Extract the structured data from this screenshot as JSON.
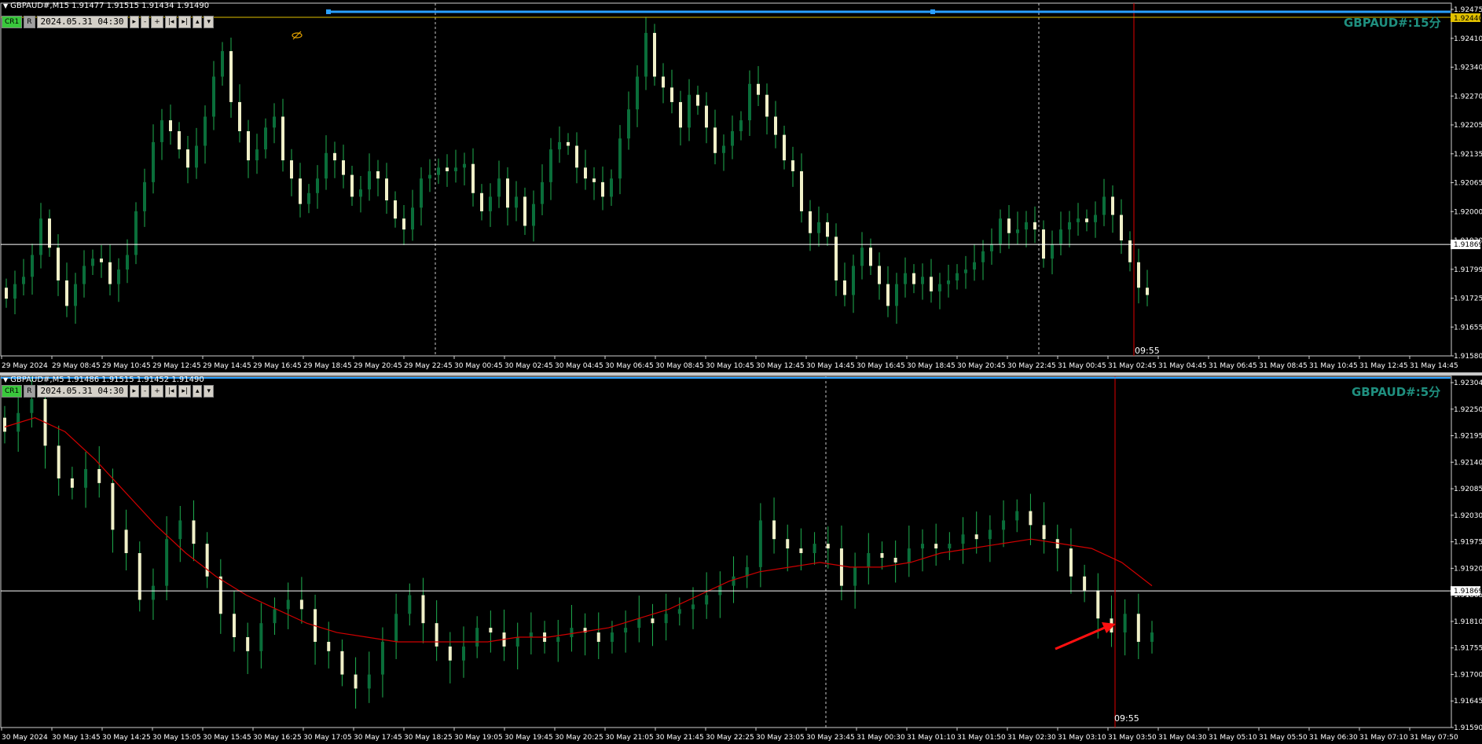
{
  "colors": {
    "bull": "#0a6e3a",
    "bear": "#f0f0c8",
    "wick": "#1fb050",
    "grid": "#808080",
    "hline": "#ffffff",
    "vred": "#e00000",
    "yellow": "#e0c000",
    "ma": "#d00000",
    "label": "#1f8f7f"
  },
  "top": {
    "info": "GBPAUD#,M15  1.91477 1.91515 1.91434 1.91490",
    "watermark": "GBPAUD#:15分",
    "toolbar": {
      "cr": "CR1",
      "r": "R",
      "date": "2024.05.31 04:30",
      "btns": [
        "▸",
        "-",
        "+",
        "|◂",
        "▸|",
        "▴",
        "▾"
      ]
    },
    "cursor_time": "09:55",
    "current_price": "1.91869",
    "price_box_yellow": "1.92440",
    "price_labels": [
      "1.92475",
      "1.92410",
      "1.92340",
      "1.92270",
      "1.92205",
      "1.92135",
      "1.92065",
      "1.92000",
      "1.91930",
      "1.91799",
      "1.91725",
      "1.91655",
      "1.91580"
    ],
    "time_labels": [
      "29 May 2024",
      "29 May 08:45",
      "29 May 10:45",
      "29 May 12:45",
      "29 May 14:45",
      "29 May 16:45",
      "29 May 18:45",
      "29 May 20:45",
      "29 May 22:45",
      "30 May 00:45",
      "30 May 02:45",
      "30 May 04:45",
      "30 May 06:45",
      "30 May 08:45",
      "30 May 10:45",
      "30 May 12:45",
      "30 May 14:45",
      "30 May 16:45",
      "30 May 18:45",
      "30 May 20:45",
      "30 May 22:45",
      "31 May 00:45",
      "31 May 02:45",
      "31 May 04:45",
      "31 May 06:45",
      "31 May 08:45",
      "31 May 10:45",
      "31 May 12:45",
      "31 May 14:45"
    ]
  },
  "bottom": {
    "info": "GBPAUD#,M5  1.91486 1.91515 1.91452 1.91490",
    "watermark": "GBPAUD#:5分",
    "toolbar": {
      "cr": "CR1",
      "r": "R",
      "date": "2024.05.31 04:30",
      "btns": [
        "▸",
        "-",
        "+",
        "|◂",
        "▸|",
        "▴",
        "▾"
      ]
    },
    "cursor_time": "09:55",
    "current_price": "1.91869",
    "price_labels": [
      "1.92304",
      "1.92250",
      "1.92195",
      "1.92140",
      "1.92085",
      "1.92030",
      "1.91975",
      "1.91920",
      "1.91865",
      "1.91810",
      "1.91755",
      "1.91700",
      "1.91645",
      "1.91590"
    ],
    "time_labels": [
      "30 May 2024",
      "30 May 13:45",
      "30 May 14:25",
      "30 May 15:05",
      "30 May 15:45",
      "30 May 16:25",
      "30 May 17:05",
      "30 May 17:45",
      "30 May 18:25",
      "30 May 19:05",
      "30 May 19:45",
      "30 May 20:25",
      "30 May 21:05",
      "30 May 21:45",
      "30 May 22:25",
      "30 May 23:05",
      "30 May 23:45",
      "31 May 00:30",
      "31 May 01:10",
      "31 May 01:50",
      "31 May 02:30",
      "31 May 03:10",
      "31 May 03:50",
      "31 May 04:30",
      "31 May 05:10",
      "31 May 05:50",
      "31 May 06:30",
      "31 May 07:10",
      "31 May 07:50"
    ]
  },
  "chart_data": [
    {
      "type": "candlestick",
      "title": "GBPAUD#,M15",
      "ylim": [
        1.9158,
        1.9248
      ],
      "series": [
        {
          "name": "GBPAUD#",
          "close": [
            1.9172,
            1.9176,
            1.9178,
            1.9184,
            1.9194,
            1.9186,
            1.9177,
            1.917,
            1.9176,
            1.9181,
            1.9183,
            1.9182,
            1.9176,
            1.918,
            1.9184,
            1.9196,
            1.9204,
            1.9215,
            1.9221,
            1.9218,
            1.9213,
            1.9208,
            1.9214,
            1.9222,
            1.9233,
            1.924,
            1.9226,
            1.9218,
            1.921,
            1.9213,
            1.9219,
            1.9222,
            1.921,
            1.9205,
            1.9198,
            1.9201,
            1.9205,
            1.9212,
            1.921,
            1.9206,
            1.92,
            1.9202,
            1.9207,
            1.9205,
            1.9199,
            1.9194,
            1.9191,
            1.9197,
            1.9205,
            1.9206,
            1.9208,
            1.9207,
            1.9208,
            1.9209,
            1.9201,
            1.9196,
            1.92,
            1.9205,
            1.9197,
            1.92,
            1.9192,
            1.9198,
            1.9204,
            1.9213,
            1.9215,
            1.9214,
            1.9208,
            1.9205,
            1.9204,
            1.92,
            1.9205,
            1.9216,
            1.9224,
            1.9233,
            1.9245,
            1.9233,
            1.923,
            1.9226,
            1.9219,
            1.9228,
            1.9225,
            1.9219,
            1.9212,
            1.9214,
            1.9218,
            1.9221,
            1.9231,
            1.9228,
            1.9222,
            1.9217,
            1.921,
            1.9207,
            1.9196,
            1.919,
            1.9193,
            1.9189,
            1.9177,
            1.9173,
            1.9181,
            1.9186,
            1.9181,
            1.9176,
            1.917,
            1.9176,
            1.9179,
            1.9176,
            1.9178,
            1.9174,
            1.9176,
            1.9177,
            1.9179,
            1.918,
            1.9182,
            1.9185,
            1.9187,
            1.9194,
            1.919,
            1.9191,
            1.9193,
            1.9191,
            1.9183,
            1.9187,
            1.9191,
            1.9193,
            1.9194,
            1.9193,
            1.9195,
            1.92,
            1.9195,
            1.9188,
            1.9182,
            1.9175,
            1.9173
          ]
        }
      ]
    },
    {
      "type": "candlestick",
      "title": "GBPAUD#,M5",
      "ylim": [
        1.9159,
        1.923
      ],
      "series": [
        {
          "name": "GBPAUD#",
          "close": [
            1.9221,
            1.9225,
            1.9228,
            1.9218,
            1.9211,
            1.9209,
            1.9213,
            1.921,
            1.92,
            1.9195,
            1.9185,
            1.9188,
            1.9198,
            1.9202,
            1.9197,
            1.919,
            1.9182,
            1.9177,
            1.9174,
            1.918,
            1.9183,
            1.9185,
            1.9183,
            1.9176,
            1.9174,
            1.9169,
            1.9166,
            1.9169,
            1.9176,
            1.9182,
            1.9186,
            1.918,
            1.9175,
            1.9172,
            1.9175,
            1.9179,
            1.9178,
            1.9175,
            1.9177,
            1.9178,
            1.9176,
            1.9177,
            1.9179,
            1.9178,
            1.9176,
            1.9178,
            1.9179,
            1.9181,
            1.918,
            1.9182,
            1.9183,
            1.9184,
            1.9186,
            1.9188,
            1.919,
            1.9192,
            1.9202,
            1.9198,
            1.9196,
            1.9195,
            1.9197,
            1.9196,
            1.9188,
            1.9192,
            1.9195,
            1.9194,
            1.9193,
            1.9196,
            1.9197,
            1.9196,
            1.9197,
            1.9199,
            1.9198,
            1.92,
            1.9202,
            1.9204,
            1.9201,
            1.9198,
            1.9196,
            1.919,
            1.9187,
            1.9181,
            1.9178,
            1.9182,
            1.9176,
            1.9178
          ]
        },
        {
          "name": "MA",
          "values": [
            1.9222,
            1.9224,
            1.9221,
            1.9215,
            1.9208,
            1.9201,
            1.9195,
            1.919,
            1.9186,
            1.9183,
            1.918,
            1.9178,
            1.9177,
            1.9176,
            1.9176,
            1.9176,
            1.9176,
            1.9177,
            1.9177,
            1.9178,
            1.9179,
            1.9181,
            1.9183,
            1.9186,
            1.9189,
            1.9191,
            1.9192,
            1.9193,
            1.9192,
            1.9192,
            1.9193,
            1.9195,
            1.9196,
            1.9197,
            1.9198,
            1.9197,
            1.9196,
            1.9193,
            1.9188
          ]
        }
      ]
    }
  ]
}
